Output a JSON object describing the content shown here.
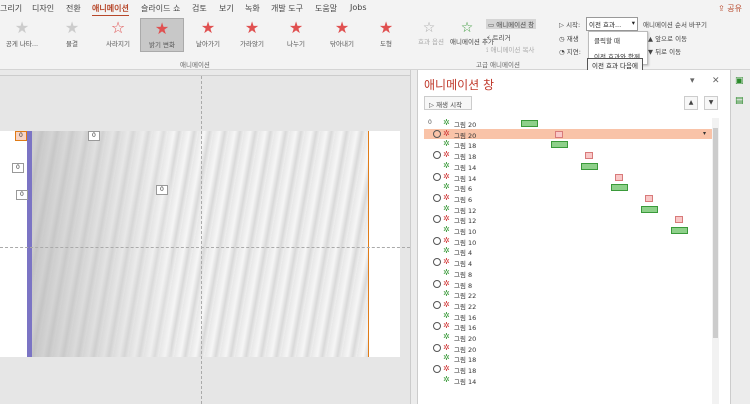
{
  "menu": {
    "tabs": [
      "그리기",
      "디자인",
      "전환",
      "애니메이션",
      "슬라이드 쇼",
      "검토",
      "보기",
      "녹화",
      "개발 도구",
      "도움말",
      "Jobs"
    ],
    "active_tab": "애니메이션",
    "share_label": "공유"
  },
  "ribbon": {
    "gallery": [
      {
        "label": "공게 나타...",
        "style": "pale"
      },
      {
        "label": "물결",
        "style": "pale"
      },
      {
        "label": "사라지기",
        "style": "red"
      },
      {
        "label": "밝기 변화",
        "style": "red",
        "selected": true
      },
      {
        "label": "날아가기",
        "style": "red"
      },
      {
        "label": "가라앉기",
        "style": "red"
      },
      {
        "label": "나누기",
        "style": "red"
      },
      {
        "label": "닦아내기",
        "style": "red"
      },
      {
        "label": "도형",
        "style": "red"
      }
    ],
    "animation_group_label": "애니메이션",
    "effect_options_label": "효과 옵션",
    "add_animation_label": "애니메이션 추가",
    "animation_pane_label": "애니메이션 창",
    "trigger_label": "트리거",
    "animation_painter_label": "애니메이션 복사",
    "advanced_group_label": "고급 애니메이션",
    "start_label": "시작:",
    "start_value": "이전 효과...",
    "duration_label": "재생",
    "delay_label": "지연:",
    "reorder_label": "애니메이션 순서 바꾸기",
    "move_earlier_label": "앞으로 이동",
    "move_later_label": "뒤로 이동",
    "start_options": [
      "클릭할 때",
      "이전 효과와 함께"
    ],
    "tooltip": "이전 효과 다음에"
  },
  "slide": {
    "tags": [
      "0",
      "0",
      "0",
      "0",
      "0"
    ]
  },
  "pane": {
    "title": "애니메이션 창",
    "play_label": "재생 시작",
    "up_label": "▲",
    "down_label": "▼",
    "close_label": "✕",
    "menu_label": "▾",
    "items": [
      {
        "num": "0",
        "clock": false,
        "icon": "green",
        "name": "그림 20"
      },
      {
        "num": "",
        "clock": true,
        "icon": "red",
        "name": "그림 20",
        "highlight": true
      },
      {
        "num": "",
        "clock": false,
        "icon": "green",
        "name": "그림 18"
      },
      {
        "num": "",
        "clock": true,
        "icon": "red",
        "name": "그림 18"
      },
      {
        "num": "",
        "clock": false,
        "icon": "green",
        "name": "그림 14"
      },
      {
        "num": "",
        "clock": true,
        "icon": "red",
        "name": "그림 14"
      },
      {
        "num": "",
        "clock": false,
        "icon": "green",
        "name": "그림 6"
      },
      {
        "num": "",
        "clock": true,
        "icon": "red",
        "name": "그림 6"
      },
      {
        "num": "",
        "clock": false,
        "icon": "green",
        "name": "그림 12"
      },
      {
        "num": "",
        "clock": true,
        "icon": "red",
        "name": "그림 12"
      },
      {
        "num": "",
        "clock": false,
        "icon": "green",
        "name": "그림 10"
      },
      {
        "num": "",
        "clock": true,
        "icon": "red",
        "name": "그림 10"
      },
      {
        "num": "",
        "clock": false,
        "icon": "green",
        "name": "그림 4"
      },
      {
        "num": "",
        "clock": true,
        "icon": "red",
        "name": "그림 4"
      },
      {
        "num": "",
        "clock": false,
        "icon": "green",
        "name": "그림 8"
      },
      {
        "num": "",
        "clock": true,
        "icon": "red",
        "name": "그림 8"
      },
      {
        "num": "",
        "clock": false,
        "icon": "green",
        "name": "그림 22"
      },
      {
        "num": "",
        "clock": true,
        "icon": "red",
        "name": "그림 22"
      },
      {
        "num": "",
        "clock": false,
        "icon": "green",
        "name": "그림 16"
      },
      {
        "num": "",
        "clock": true,
        "icon": "red",
        "name": "그림 16"
      },
      {
        "num": "",
        "clock": false,
        "icon": "green",
        "name": "그림 20"
      },
      {
        "num": "",
        "clock": true,
        "icon": "red",
        "name": "그림 20"
      },
      {
        "num": "",
        "clock": false,
        "icon": "green",
        "name": "그림 18"
      },
      {
        "num": "",
        "clock": true,
        "icon": "red",
        "name": "그림 18"
      },
      {
        "num": "",
        "clock": false,
        "icon": "green",
        "name": "그림 14"
      }
    ]
  },
  "colors": {
    "accent": "#b7472a",
    "pane_title": "#c0392b",
    "highlight": "#f9c3a8"
  }
}
